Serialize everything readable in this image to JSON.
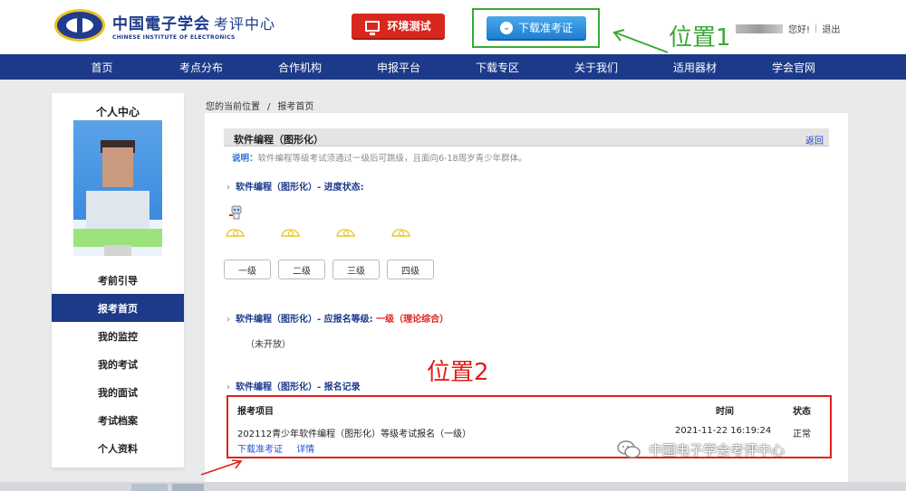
{
  "header": {
    "logo_cn": "中国電子学会",
    "logo_sub": "考评中心",
    "logo_en": "CHINESE INSTITUTE OF ELECTRONICS",
    "env_test_label": "环境测试",
    "download_ticket_label": "下载准考证",
    "annotation_pos1": "位置1",
    "greeting": "您好!",
    "logout": "退出"
  },
  "nav": {
    "items": [
      "首页",
      "考点分布",
      "合作机构",
      "申报平台",
      "下载专区",
      "关于我们",
      "适用器材",
      "学会官网"
    ]
  },
  "sidebar": {
    "title": "个人中心",
    "items": [
      "考前引导",
      "报考首页",
      "我的监控",
      "我的考试",
      "我的面试",
      "考试档案",
      "个人资料"
    ],
    "active_index": 1
  },
  "breadcrumb": {
    "current": "您的当前位置",
    "page": "报考首页"
  },
  "main": {
    "title": "软件编程（图形化）",
    "back": "返回",
    "note_label": "说明：",
    "note_text": "软件编程等级考试须通过一级后可跳级，且面向6-18周岁青少年群体。",
    "progress_section": "软件编程（图形化）- 进度状态:",
    "levels": [
      "一级",
      "二级",
      "三级",
      "四级"
    ],
    "apply_section": "软件编程（图形化）- 应报名等级:",
    "apply_level": "一级（理论综合）",
    "not_open": "（未开放）",
    "record_section": "软件编程（图形化）- 报名记录",
    "annotation_pos2": "位置2",
    "record": {
      "headers": [
        "报考项目",
        "时间",
        "状态"
      ],
      "rows": [
        {
          "project": "202112青少年软件编程（图形化）等级考试报名（一级）",
          "time": "2021-11-22 16:19:24",
          "status": "正常"
        }
      ],
      "link_ticket": "下载准考证",
      "link_detail": "详情"
    }
  },
  "watermark": {
    "text": "中国电子学会考评中心"
  },
  "colors": {
    "nav_blue": "#1d3a8a",
    "annotation_green": "#3aaa35",
    "annotation_red": "#e0201a",
    "env_red": "#d9271f",
    "download_blue": "#1f7fd2"
  }
}
